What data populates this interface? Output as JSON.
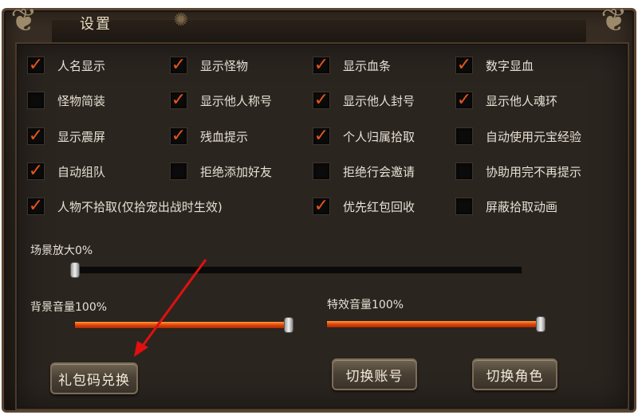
{
  "window": {
    "title": "设置"
  },
  "options": [
    {
      "label": "人名显示",
      "checked": true
    },
    {
      "label": "显示怪物",
      "checked": true
    },
    {
      "label": "显示血条",
      "checked": true
    },
    {
      "label": "数字显血",
      "checked": true
    },
    {
      "label": "怪物简装",
      "checked": false
    },
    {
      "label": "显示他人称号",
      "checked": true
    },
    {
      "label": "显示他人封号",
      "checked": true
    },
    {
      "label": "显示他人魂环",
      "checked": true
    },
    {
      "label": "显示震屏",
      "checked": true
    },
    {
      "label": "残血提示",
      "checked": true
    },
    {
      "label": "个人归属拾取",
      "checked": true
    },
    {
      "label": "自动使用元宝经验",
      "checked": false
    },
    {
      "label": "自动组队",
      "checked": true
    },
    {
      "label": "拒绝添加好友",
      "checked": false
    },
    {
      "label": "拒绝行会邀请",
      "checked": false
    },
    {
      "label": "协助用完不再提示",
      "checked": false
    },
    {
      "label": "人物不拾取(仅拾宠出战时生效)",
      "checked": true
    },
    {
      "label": "优先红包回收",
      "checked": true
    },
    {
      "label": "屏蔽拾取动画",
      "checked": false
    }
  ],
  "sliders": {
    "zoom": {
      "label": "场景放大0%",
      "value": 0
    },
    "bgm": {
      "label": "背景音量100%",
      "value": 100
    },
    "sfx": {
      "label": "特效音量100%",
      "value": 100
    }
  },
  "buttons": {
    "redeem": "礼包码兑换",
    "switch_account": "切换账号",
    "switch_role": "切换角色"
  },
  "colors": {
    "check": "#e8551c",
    "fill": "#e0460c",
    "annotation_arrow": "#e01010"
  }
}
